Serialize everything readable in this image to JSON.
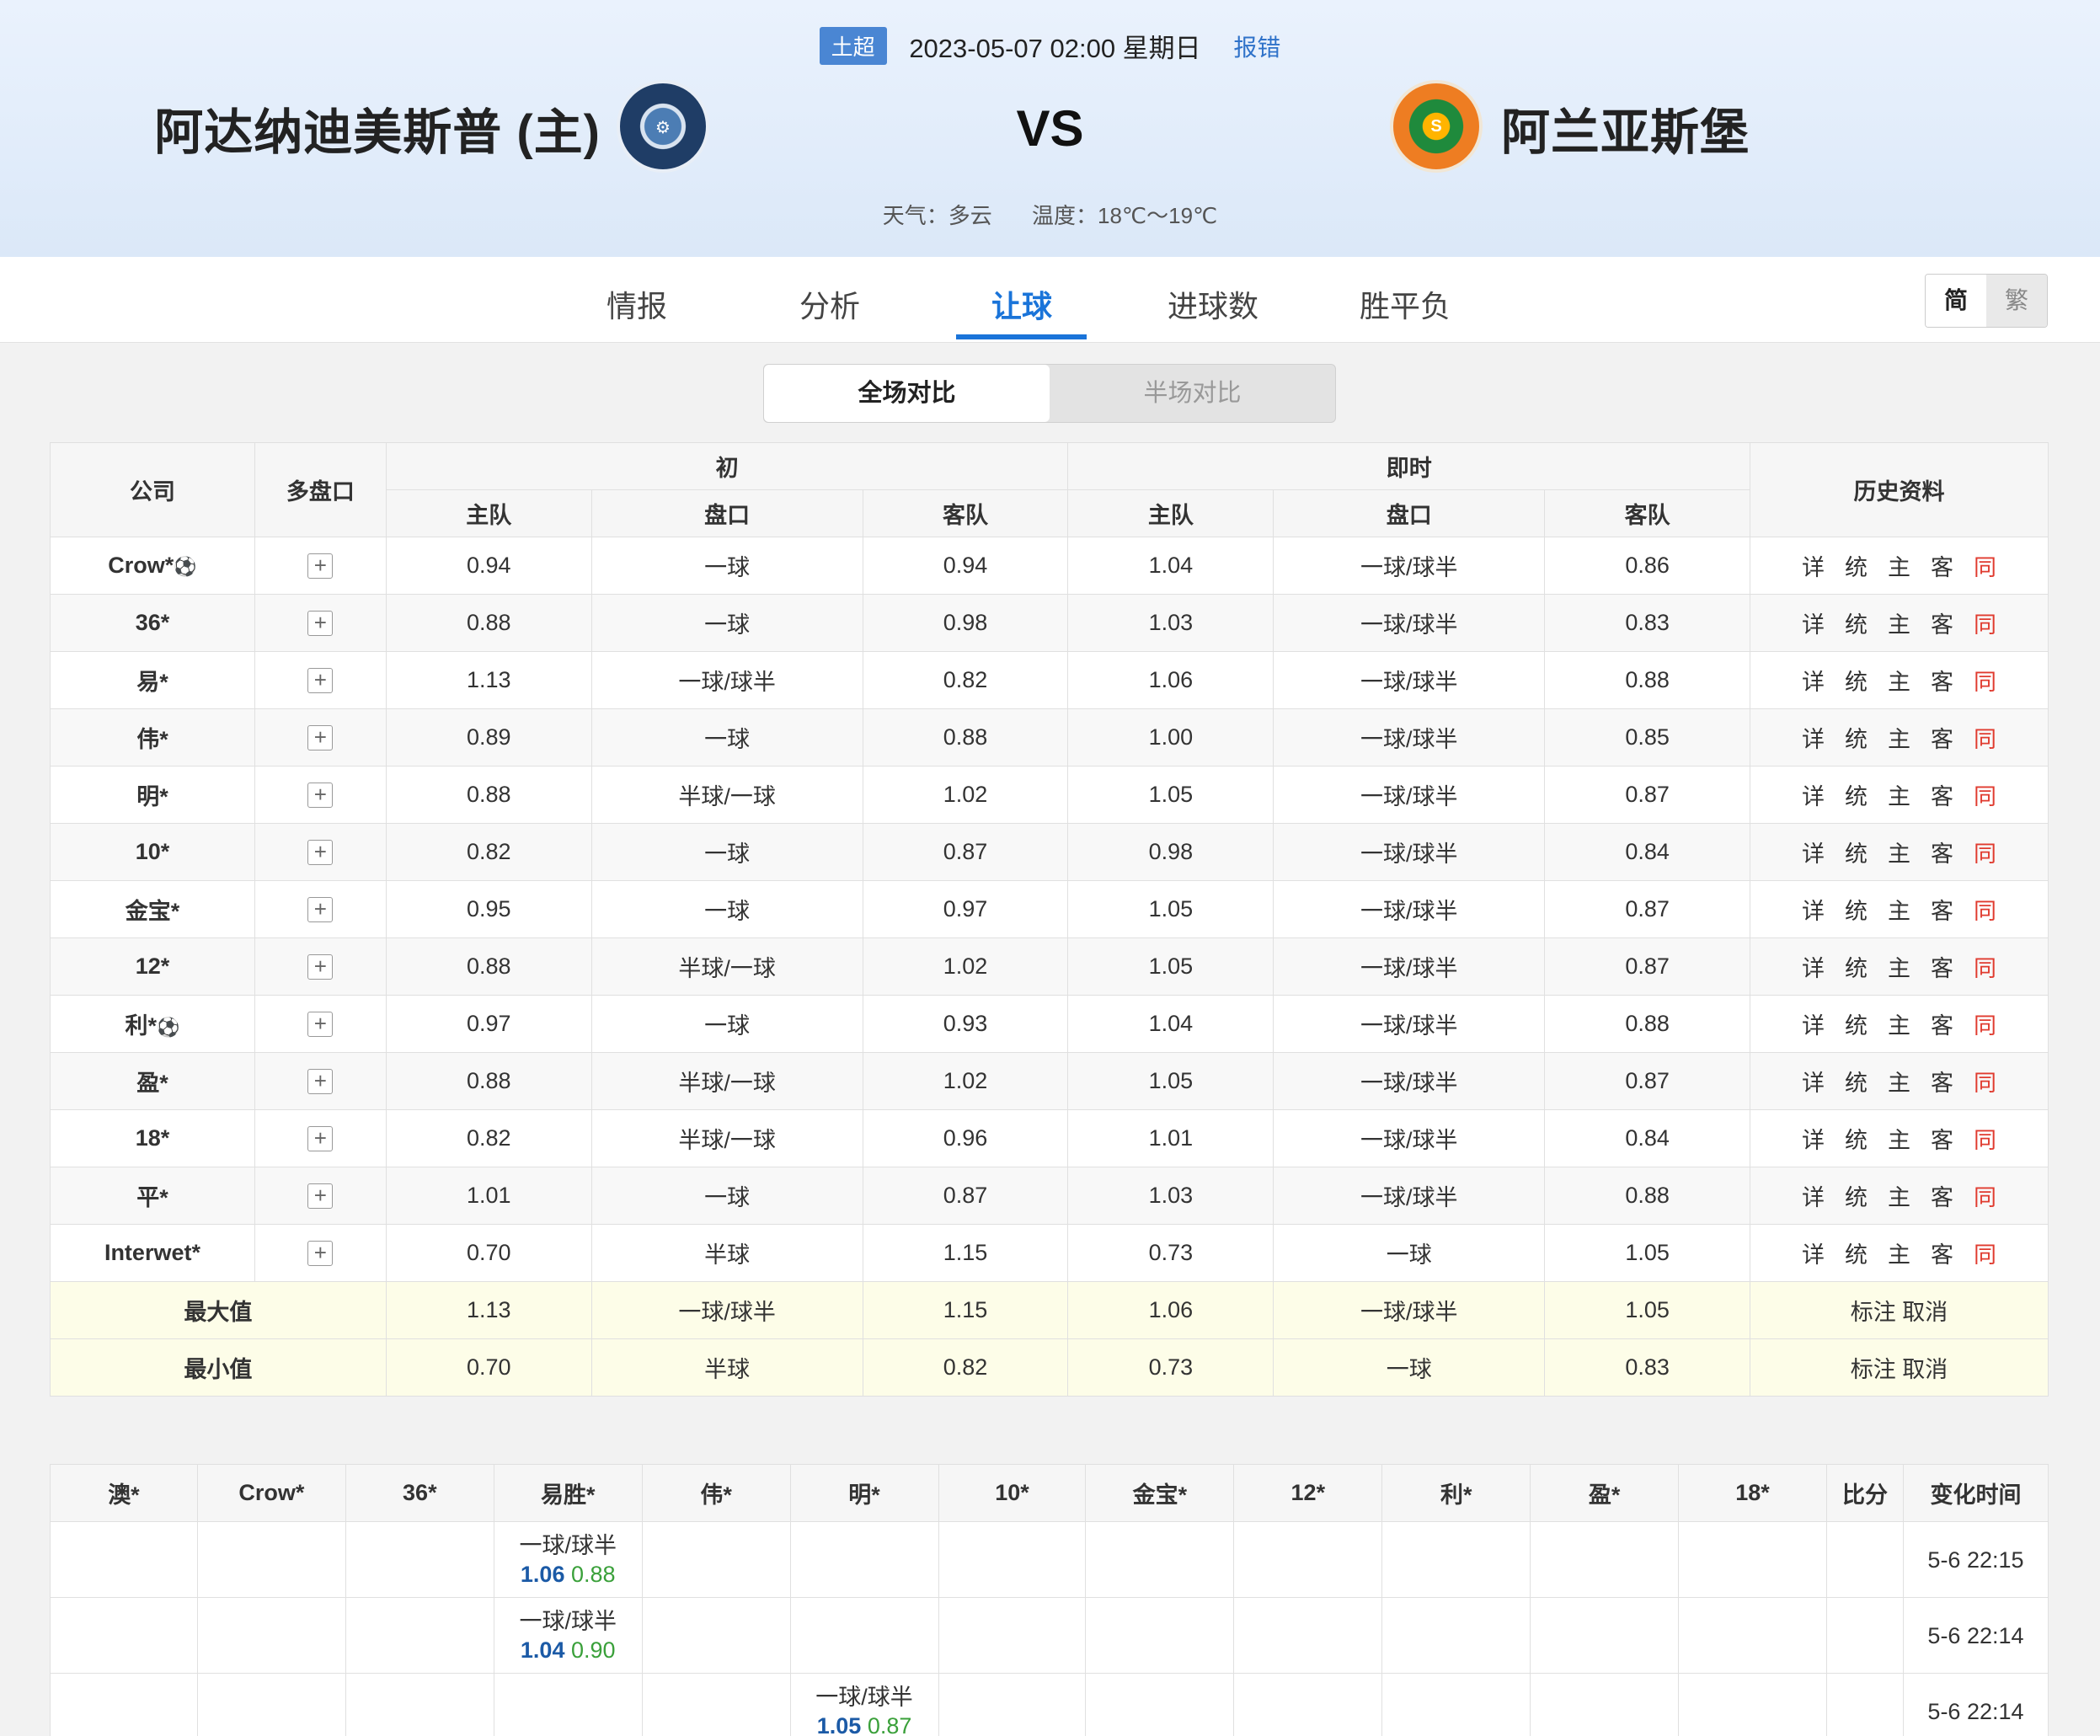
{
  "match": {
    "league": "土超",
    "datetime": "2023-05-07 02:00 星期日",
    "report": "报错",
    "home": "阿达纳迪美斯普 (主)",
    "away": "阿兰亚斯堡",
    "home_logo": "ADANA DEMIRSPOR",
    "away_logo": "ALANYASPOR",
    "vs": "VS",
    "weather": "天气：多云",
    "temperature": "温度：18℃～19℃"
  },
  "tabs": [
    "情报",
    "分析",
    "让球",
    "进球数",
    "胜平负"
  ],
  "active_tab": "让球",
  "lang": {
    "simplified": "简",
    "traditional": "繁"
  },
  "segment": {
    "full": "全场对比",
    "half": "半场对比"
  },
  "odds_header": {
    "company": "公司",
    "multi": "多盘口",
    "initial": "初",
    "live": "即时",
    "home": "主队",
    "line": "盘口",
    "away": "客队",
    "history": "历史资料"
  },
  "history_links": [
    "详",
    "统",
    "主",
    "客",
    "同"
  ],
  "rows": [
    {
      "company": "Crow*",
      "ball": true,
      "ih": "0.94",
      "il": "一球",
      "ia": "0.94",
      "lh": "1.04",
      "ll": "一球/球半",
      "la": "0.86"
    },
    {
      "company": "36*",
      "ball": false,
      "ih": "0.88",
      "il": "一球",
      "ia": "0.98",
      "lh": "1.03",
      "ll": "一球/球半",
      "la": "0.83"
    },
    {
      "company": "易*",
      "ball": false,
      "ih": "1.13",
      "il": "一球/球半",
      "ia": "0.82",
      "lh": "1.06",
      "ll": "一球/球半",
      "la": "0.88"
    },
    {
      "company": "伟*",
      "ball": false,
      "ih": "0.89",
      "il": "一球",
      "ia": "0.88",
      "lh": "1.00",
      "ll": "一球/球半",
      "la": "0.85"
    },
    {
      "company": "明*",
      "ball": false,
      "ih": "0.88",
      "il": "半球/一球",
      "ia": "1.02",
      "lh": "1.05",
      "ll": "一球/球半",
      "la": "0.87"
    },
    {
      "company": "10*",
      "ball": false,
      "ih": "0.82",
      "il": "一球",
      "ia": "0.87",
      "lh": "0.98",
      "ll": "一球/球半",
      "la": "0.84"
    },
    {
      "company": "金宝*",
      "ball": false,
      "ih": "0.95",
      "il": "一球",
      "ia": "0.97",
      "lh": "1.05",
      "ll": "一球/球半",
      "la": "0.87"
    },
    {
      "company": "12*",
      "ball": false,
      "ih": "0.88",
      "il": "半球/一球",
      "ia": "1.02",
      "lh": "1.05",
      "ll": "一球/球半",
      "la": "0.87"
    },
    {
      "company": "利*",
      "ball": true,
      "ih": "0.97",
      "il": "一球",
      "ia": "0.93",
      "lh": "1.04",
      "ll": "一球/球半",
      "la": "0.88"
    },
    {
      "company": "盈*",
      "ball": false,
      "ih": "0.88",
      "il": "半球/一球",
      "ia": "1.02",
      "lh": "1.05",
      "ll": "一球/球半",
      "la": "0.87"
    },
    {
      "company": "18*",
      "ball": false,
      "ih": "0.82",
      "il": "半球/一球",
      "ia": "0.96",
      "lh": "1.01",
      "ll": "一球/球半",
      "la": "0.84"
    },
    {
      "company": "平*",
      "ball": false,
      "ih": "1.01",
      "il": "一球",
      "ia": "0.87",
      "lh": "1.03",
      "ll": "一球/球半",
      "la": "0.88"
    },
    {
      "company": "Interwet*",
      "ball": false,
      "ih": "0.70",
      "il": "半球",
      "ia": "1.15",
      "lh": "0.73",
      "ll": "一球",
      "la": "1.05"
    }
  ],
  "summary": [
    {
      "label": "最大值",
      "ih": "1.13",
      "il": "一球/球半",
      "ia": "1.15",
      "lh": "1.06",
      "ll": "一球/球半",
      "la": "1.05",
      "mark": "标注",
      "cancel": "取消"
    },
    {
      "label": "最小值",
      "ih": "0.70",
      "il": "半球",
      "ia": "0.82",
      "lh": "0.73",
      "ll": "一球",
      "la": "0.83",
      "mark": "标注",
      "cancel": "取消"
    }
  ],
  "change_header": [
    "澳*",
    "Crow*",
    "36*",
    "易胜*",
    "伟*",
    "明*",
    "10*",
    "金宝*",
    "12*",
    "利*",
    "盈*",
    "18*",
    "比分",
    "变化时间"
  ],
  "changes": [
    {
      "col": 3,
      "line": "一球/球半",
      "home": "1.06",
      "away": "0.88",
      "time": "5-6 22:15"
    },
    {
      "col": 3,
      "line": "一球/球半",
      "home": "1.04",
      "away": "0.90",
      "time": "5-6 22:14"
    },
    {
      "col": 5,
      "line": "一球/球半",
      "home": "1.05",
      "away": "0.87",
      "time": "5-6 22:14"
    }
  ]
}
